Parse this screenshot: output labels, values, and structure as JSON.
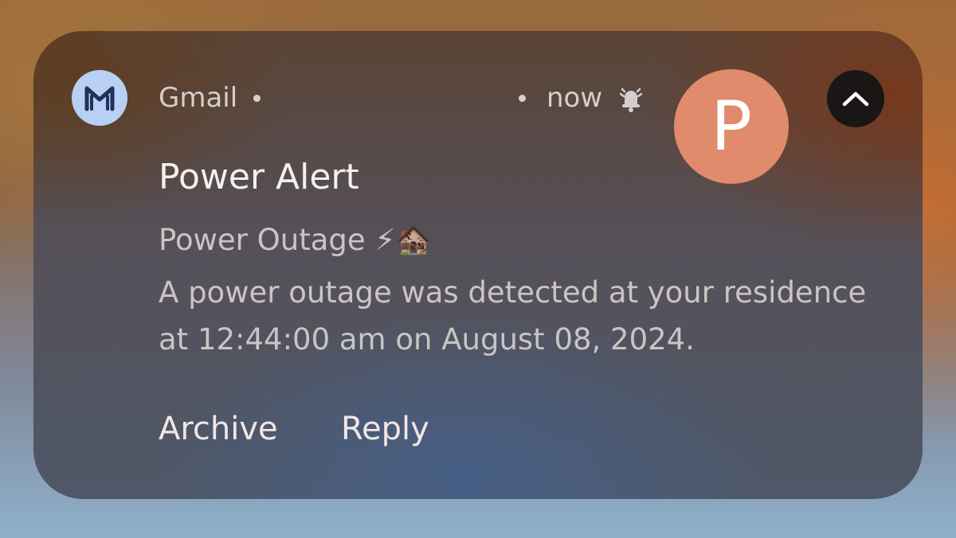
{
  "notification": {
    "app_name": "Gmail",
    "app_icon": "gmail-m-icon",
    "time": "now",
    "status_icon": "bell-alarm-icon",
    "avatar_letter": "P",
    "avatar_color": "#e08b6b",
    "collapse_icon": "chevron-up-icon",
    "title": "Power Alert",
    "subject": "Power Outage ⚡🏚️",
    "body": "A power outage was detected at your residence at 12:44:00 am on August 08, 2024.",
    "actions": {
      "archive_label": "Archive",
      "reply_label": "Reply"
    }
  }
}
